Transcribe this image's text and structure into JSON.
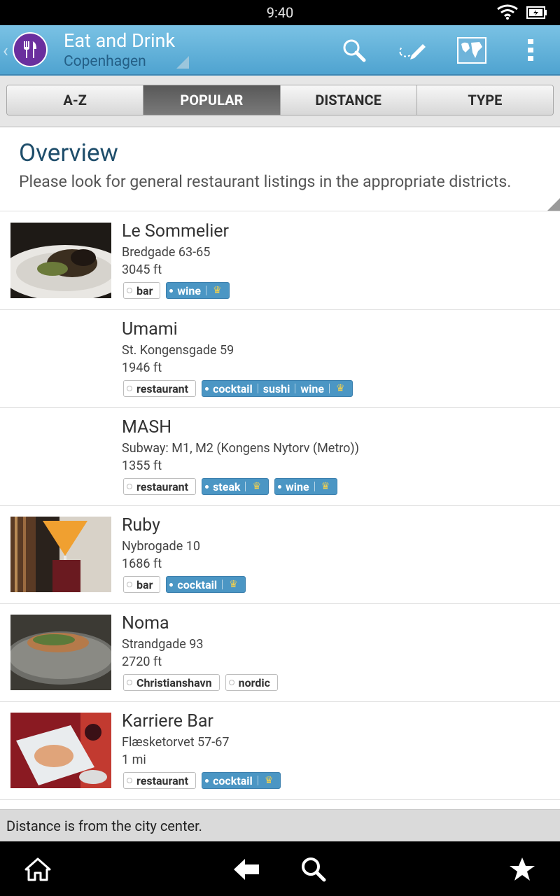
{
  "status_bar": {
    "time": "9:40"
  },
  "action_bar": {
    "title": "Eat and Drink",
    "subtitle": "Copenhagen",
    "icons": [
      "search-icon",
      "edit-icon",
      "map-icon",
      "overflow-menu-icon"
    ]
  },
  "tabs": [
    {
      "label": "A-Z",
      "active": false
    },
    {
      "label": "POPULAR",
      "active": true
    },
    {
      "label": "DISTANCE",
      "active": false
    },
    {
      "label": "TYPE",
      "active": false
    }
  ],
  "overview": {
    "title": "Overview",
    "text": "Please look for general restaurant listings in the appropriate districts."
  },
  "listings": [
    {
      "name": "Le Sommelier",
      "address": "Bredgade 63-65",
      "distance": "3045 ft",
      "tags": [
        {
          "style": "plain",
          "labels": [
            "bar"
          ]
        },
        {
          "style": "blue",
          "labels": [
            "wine"
          ],
          "crown": true
        }
      ]
    },
    {
      "name": "Umami",
      "address": "St. Kongensgade 59",
      "distance": "1946 ft",
      "tags": [
        {
          "style": "plain",
          "labels": [
            "restaurant"
          ]
        },
        {
          "style": "blue",
          "labels": [
            "cocktail",
            "sushi",
            "wine"
          ],
          "crown": true
        }
      ]
    },
    {
      "name": "MASH",
      "address": "Subway: M1, M2 (Kongens Nytorv (Metro))",
      "distance": "1355 ft",
      "tags": [
        {
          "style": "plain",
          "labels": [
            "restaurant"
          ]
        },
        {
          "style": "blue",
          "labels": [
            "steak"
          ],
          "crown": true
        },
        {
          "style": "blue",
          "labels": [
            "wine"
          ],
          "crown": true
        }
      ]
    },
    {
      "name": "Ruby",
      "address": "Nybrogade 10",
      "distance": "1686 ft",
      "tags": [
        {
          "style": "plain",
          "labels": [
            "bar"
          ]
        },
        {
          "style": "blue",
          "labels": [
            "cocktail"
          ],
          "crown": true
        }
      ]
    },
    {
      "name": "Noma",
      "address": "Strandgade 93",
      "distance": "2720 ft",
      "tags": [
        {
          "style": "plain",
          "labels": [
            "Christianshavn"
          ]
        },
        {
          "style": "plain",
          "labels": [
            "nordic"
          ]
        }
      ]
    },
    {
      "name": "Karriere Bar",
      "address": "Flæsketorvet 57-67",
      "distance": "1 mi",
      "tags": [
        {
          "style": "plain",
          "labels": [
            "restaurant"
          ]
        },
        {
          "style": "blue",
          "labels": [
            "cocktail"
          ],
          "crown": true
        }
      ]
    }
  ],
  "footnote": "Distance is from the city center.",
  "nav_bar": {
    "icons": [
      "home-icon",
      "back-icon",
      "search-icon",
      "favorites-star-icon"
    ]
  }
}
